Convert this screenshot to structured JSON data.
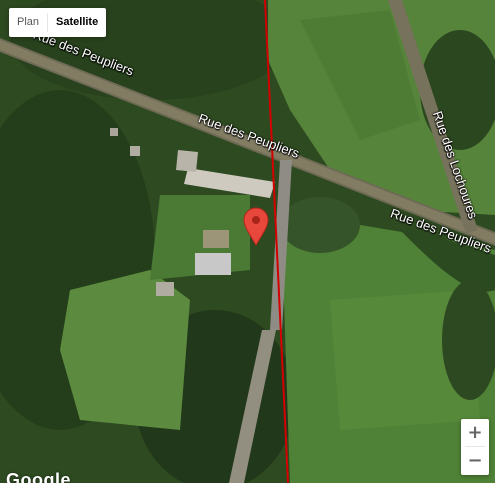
{
  "map": {
    "type": "satellite",
    "road_labels": {
      "peupliers_nw": "Rue des Peupliers",
      "peupliers_center": "Rue des Peupliers",
      "peupliers_e": "Rue des Peupliers",
      "lochoures": "Rue des Lochoures"
    },
    "line_color": "#d40000",
    "pin_color": "#e8483b"
  },
  "controls": {
    "map_type": {
      "plan_label": "Plan",
      "satellite_label": "Satellite",
      "selected": "Satellite"
    },
    "zoom_in": "+",
    "zoom_out": "−"
  },
  "branding": {
    "logo": "Google"
  }
}
